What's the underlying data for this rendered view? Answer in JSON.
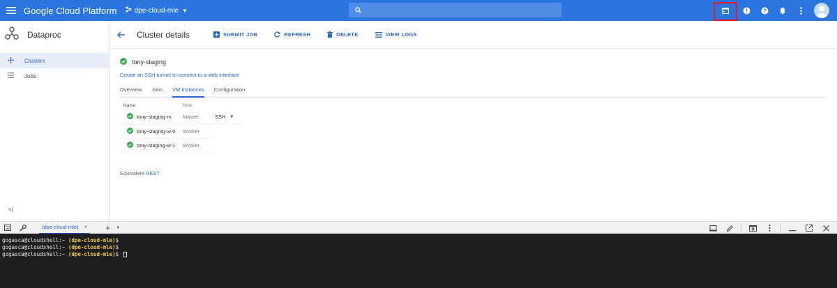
{
  "topbar": {
    "title": "Google Cloud Platform",
    "project": "dpe-cloud-mle",
    "colors": {
      "bar": "#2a75e0",
      "highlight": "#e01e1e"
    },
    "icons": [
      "menu-icon",
      "project-icon",
      "search-icon",
      "cloud-shell-icon",
      "notifications-info-icon",
      "help-icon",
      "bell-icon",
      "more-vert-icon",
      "avatar"
    ]
  },
  "sidebar": {
    "product": "Dataproc",
    "items": [
      {
        "label": "Clusters",
        "icon": "clusters-icon",
        "active": true
      },
      {
        "label": "Jobs",
        "icon": "jobs-icon",
        "active": false
      }
    ],
    "collapse": "<|"
  },
  "toolbar": {
    "title": "Cluster details",
    "buttons": [
      {
        "label": "SUBMIT JOB",
        "icon": "add-box-icon"
      },
      {
        "label": "REFRESH",
        "icon": "refresh-icon"
      },
      {
        "label": "DELETE",
        "icon": "trash-icon"
      },
      {
        "label": "VIEW LOGS",
        "icon": "list-icon"
      }
    ]
  },
  "cluster": {
    "name": "tony-staging",
    "ssh_tunnel_link": "Create an SSH tunnel to connect to a web interface",
    "tabs": [
      "Overview",
      "Jobs",
      "VM Instances",
      "Configuration"
    ],
    "active_tab": "VM Instances",
    "table": {
      "headers": [
        "Name",
        "Role"
      ],
      "rows": [
        {
          "name": "tony-staging-m",
          "role": "Master",
          "ssh": "SSH"
        },
        {
          "name": "tony-staging-w-0",
          "role": "Worker"
        },
        {
          "name": "tony-staging-w-1",
          "role": "Worker"
        }
      ]
    },
    "equivalent": "Equivalent",
    "rest": "REST"
  },
  "shell": {
    "tab_label": "(dpe-cloud-mle)",
    "tab_close": "×",
    "plus": "+",
    "lines": [
      {
        "prompt": "gogasca@cloudshell:~ ",
        "project": "(dpe-cloud-mle)",
        "suffix": "$"
      },
      {
        "prompt": "gogasca@cloudshell:~ ",
        "project": "(dpe-cloud-mle)",
        "suffix": "$"
      },
      {
        "prompt": "gogasca@cloudshell:~ ",
        "project": "(dpe-cloud-mle)",
        "suffix": "$ "
      }
    ]
  }
}
